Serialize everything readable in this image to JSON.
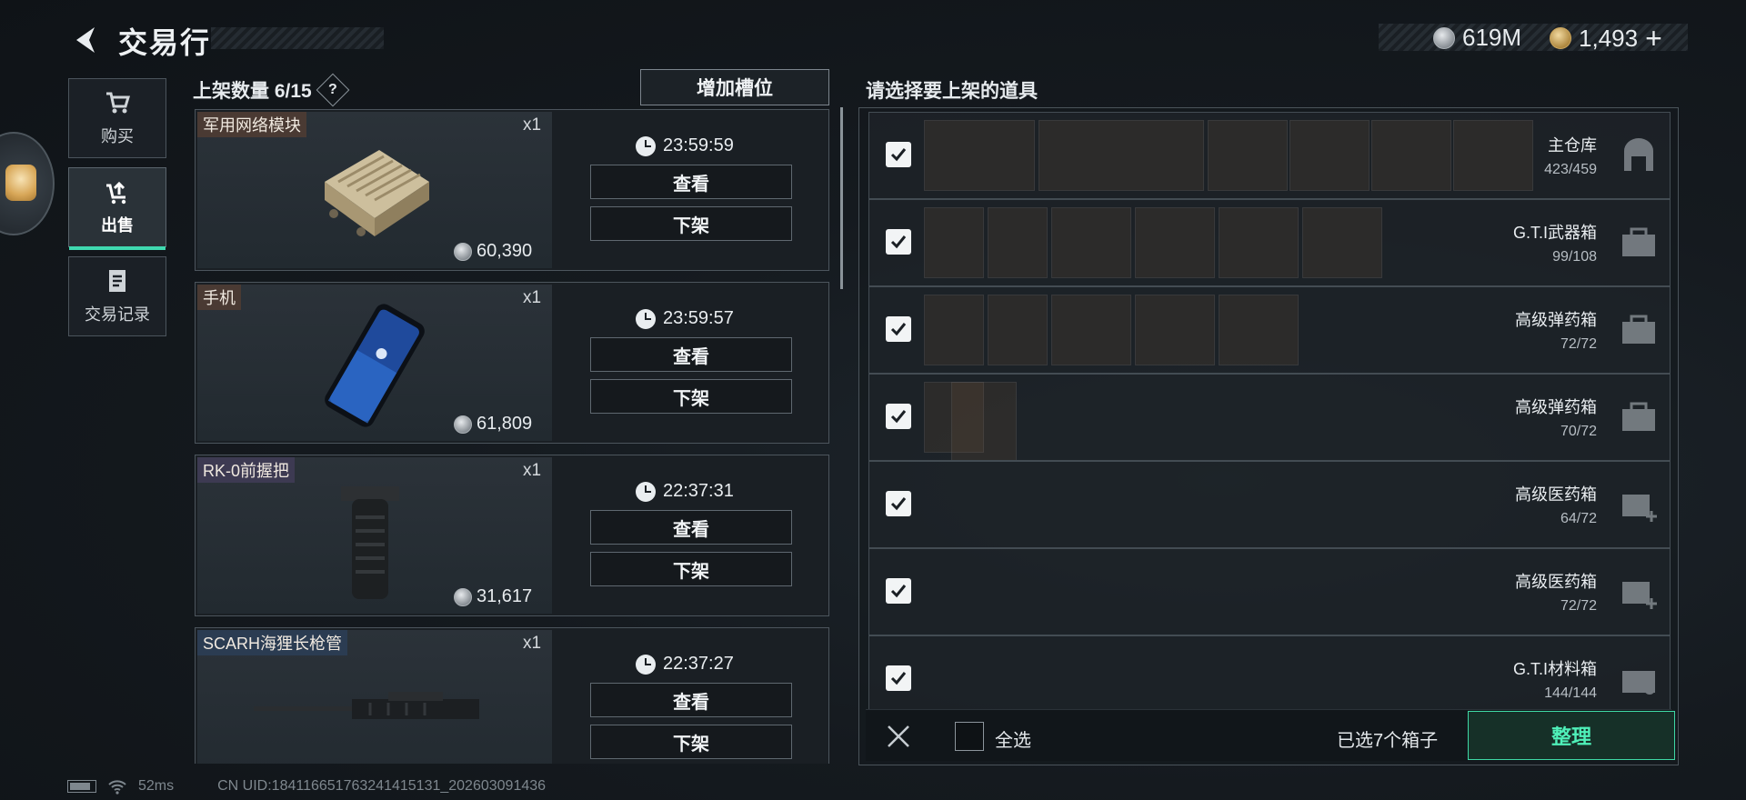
{
  "header": {
    "title": "交易行",
    "currency_silver": "619M",
    "currency_gold": "1,493",
    "plus_label": "+"
  },
  "sidebar": {
    "items": [
      {
        "label": "购买",
        "icon": "cart-icon"
      },
      {
        "label": "出售",
        "icon": "sell-icon",
        "active": true
      },
      {
        "label": "交易记录",
        "icon": "record-icon"
      }
    ]
  },
  "listings": {
    "count_label": "上架数量 6/15",
    "help_label": "?",
    "add_slot_label": "增加槽位",
    "view_label": "查看",
    "delist_label": "下架",
    "items": [
      {
        "name": "军用网络模块",
        "qty": "x1",
        "price": "60,390",
        "timer": "23:59:59",
        "rarity": "brown"
      },
      {
        "name": "手机",
        "qty": "x1",
        "price": "61,809",
        "timer": "23:59:57",
        "rarity": "brown"
      },
      {
        "name": "RK-0前握把",
        "qty": "x1",
        "price": "31,617",
        "timer": "22:37:31",
        "rarity": "purple"
      },
      {
        "name": "SCARH海狸长枪管",
        "qty": "x1",
        "price": "",
        "timer": "22:37:27",
        "rarity": "blue"
      }
    ]
  },
  "selection": {
    "title": "请选择要上架的道具",
    "boxes": [
      {
        "name": "主仓库",
        "count": "423/459",
        "checked": true
      },
      {
        "name": "G.T.I武器箱",
        "count": "99/108",
        "checked": true
      },
      {
        "name": "高级弹药箱",
        "count": "72/72",
        "checked": true
      },
      {
        "name": "高级弹药箱",
        "count": "70/72",
        "checked": true
      },
      {
        "name": "高级医药箱",
        "count": "64/72",
        "checked": true
      },
      {
        "name": "高级医药箱",
        "count": "72/72",
        "checked": true
      },
      {
        "name": "G.T.I材料箱",
        "count": "144/144",
        "checked": true
      }
    ],
    "select_all_label": "全选",
    "selected_text": "已选7个箱子",
    "organize_label": "整理"
  },
  "footer": {
    "ping": "52ms",
    "uid": "CN UID:184116651763241415131_202603091436"
  }
}
